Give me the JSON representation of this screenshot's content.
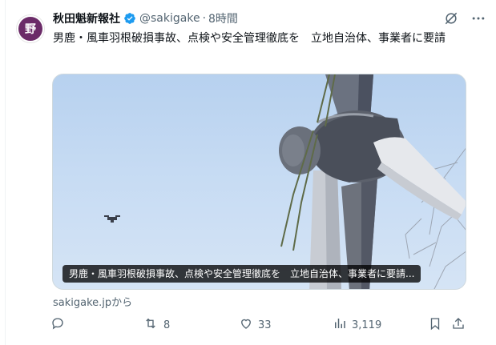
{
  "account": {
    "display_name": "秋田魁新報社",
    "handle": "@sakigake",
    "separator": "·",
    "time": "8時間",
    "avatar_glyph": "野"
  },
  "tweet": {
    "text": "男鹿・風車羽根破損事故、点検や安全管理徹底を　立地自治体、事業者に要請"
  },
  "media": {
    "caption": "男鹿・風車羽根破損事故、点検や安全管理徹底を　立地自治体、事業者に要請..."
  },
  "link_source": "sakigake.jpから",
  "actions": {
    "reply": {
      "icon": "reply-icon"
    },
    "repost": {
      "icon": "repost-icon",
      "count": "8"
    },
    "like": {
      "icon": "heart-icon",
      "count": "33"
    },
    "views": {
      "icon": "views-icon",
      "count": "3,119"
    },
    "bookmark": {
      "icon": "bookmark-icon"
    },
    "share": {
      "icon": "share-icon"
    }
  },
  "colors": {
    "text": "#0f1419",
    "secondary": "#536471",
    "verified": "#1d9bf0",
    "avatar_bg": "#6b2b68"
  }
}
